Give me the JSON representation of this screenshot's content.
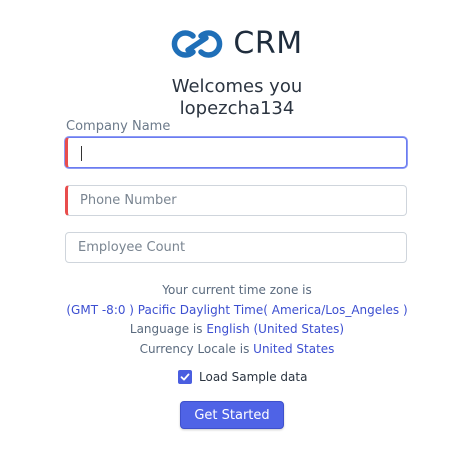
{
  "brand": {
    "name": "CRM",
    "logo_icon": "zoho-crm-logo-icon"
  },
  "welcome": {
    "line1": "Welcomes you",
    "line2": "lopezcha134"
  },
  "form": {
    "company_label": "Company Name",
    "company_value": "",
    "phone_placeholder": "Phone Number",
    "employee_placeholder": "Employee Count"
  },
  "info": {
    "timezone_label": "Your current time zone is",
    "timezone_value": "(GMT -8:0 ) Pacific Daylight Time( America/Los_Angeles )",
    "language_label": "Language is",
    "language_value": "English (United States)",
    "currency_label": "Currency Locale is",
    "currency_value": "United States"
  },
  "sample_data": {
    "label": "Load Sample data",
    "checked": true
  },
  "submit": {
    "label": "Get Started"
  },
  "colors": {
    "accent": "#4f63e6",
    "required": "#e84d4d",
    "link": "#3c4fd1",
    "logo": "#1f6fb8"
  }
}
